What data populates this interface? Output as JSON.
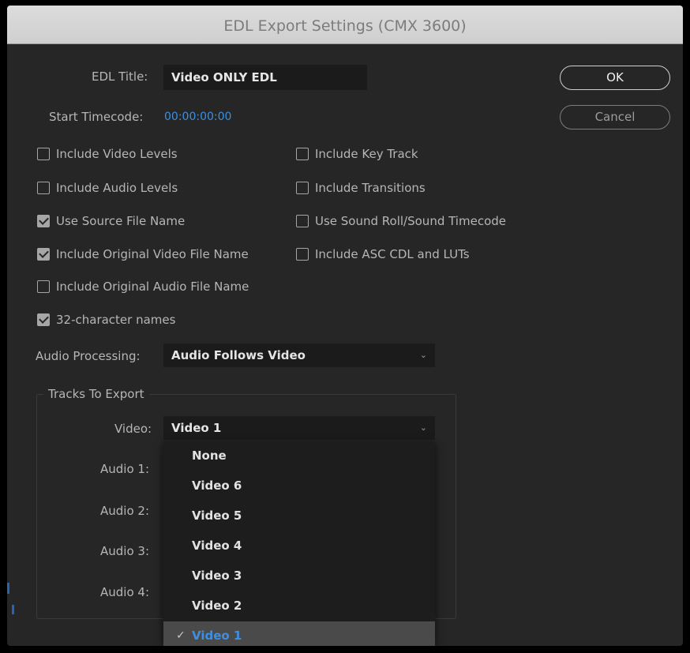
{
  "dialog": {
    "title": "EDL Export Settings (CMX 3600)",
    "edl_title_label": "EDL Title:",
    "edl_title_value": "Video ONLY EDL",
    "start_timecode_label": "Start Timecode:",
    "start_timecode_value": "00:00:00:00",
    "ok_label": "OK",
    "cancel_label": "Cancel"
  },
  "options": {
    "left": [
      {
        "label": "Include Video Levels",
        "checked": false
      },
      {
        "label": "Include Audio Levels",
        "checked": false
      },
      {
        "label": "Use Source File Name",
        "checked": true
      },
      {
        "label": "Include Original Video File Name",
        "checked": true
      },
      {
        "label": "Include Original Audio File Name",
        "checked": false
      },
      {
        "label": "32-character names",
        "checked": true
      }
    ],
    "right": [
      {
        "label": "Include Key Track",
        "checked": false
      },
      {
        "label": "Include Transitions",
        "checked": false
      },
      {
        "label": "Use Sound Roll/Sound Timecode",
        "checked": false
      },
      {
        "label": "Include ASC CDL and LUTs",
        "checked": false
      }
    ]
  },
  "audio_processing": {
    "label": "Audio Processing:",
    "value": "Audio Follows Video"
  },
  "tracks": {
    "group_label": "Tracks To Export",
    "video_label": "Video:",
    "video_value": "Video 1",
    "audio_labels": [
      "Audio 1:",
      "Audio 2:",
      "Audio 3:",
      "Audio 4:"
    ]
  },
  "video_menu": {
    "items": [
      "None",
      "Video 6",
      "Video 5",
      "Video 4",
      "Video 3",
      "Video 2",
      "Video 1"
    ],
    "selected": "Video 1"
  },
  "colors": {
    "accent": "#3d8fe0",
    "dialog_bg": "#262626",
    "field_bg": "#1b1b1b"
  }
}
